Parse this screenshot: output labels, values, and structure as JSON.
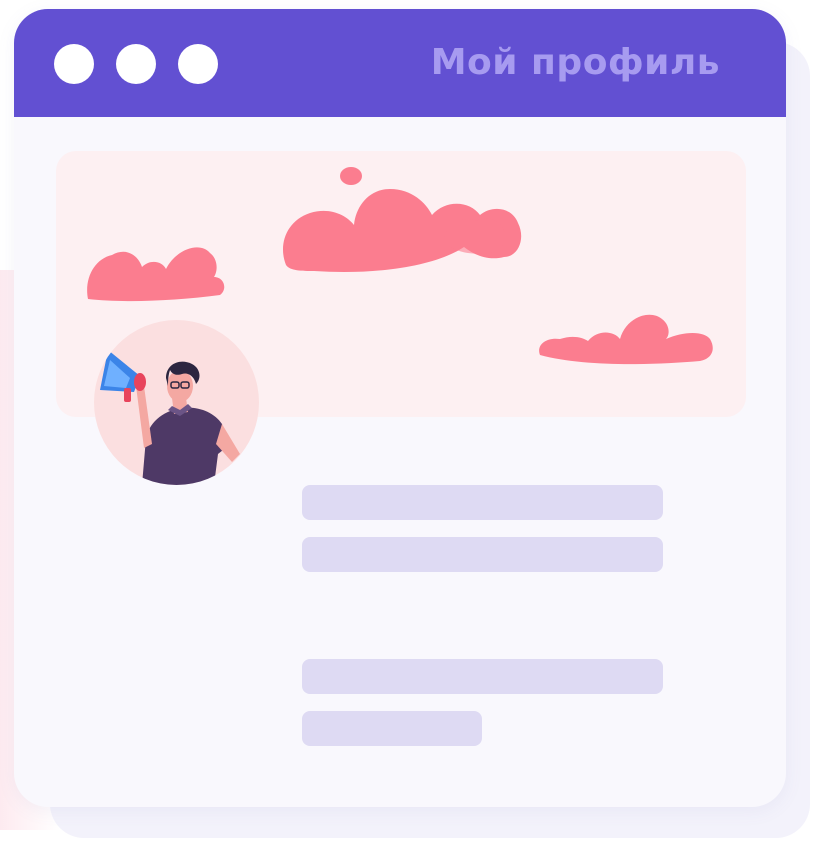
{
  "window": {
    "title": "Мой профиль"
  },
  "icons": {
    "window_controls": [
      "window-dot-icon",
      "window-dot-icon",
      "window-dot-icon"
    ],
    "avatar": "man-with-megaphone-illustration",
    "clouds": "cloud-illustration"
  },
  "colors": {
    "title_bar": "#6250d2",
    "title_text": "#a79bf0",
    "window_background": "#f9f8fd",
    "back_card": "#f3f2fb",
    "cover_background": "#fdf0f2",
    "cloud": "#fb7d8f",
    "avatar_background": "#fbdfe0",
    "placeholder_bar": "#dedaf3"
  }
}
